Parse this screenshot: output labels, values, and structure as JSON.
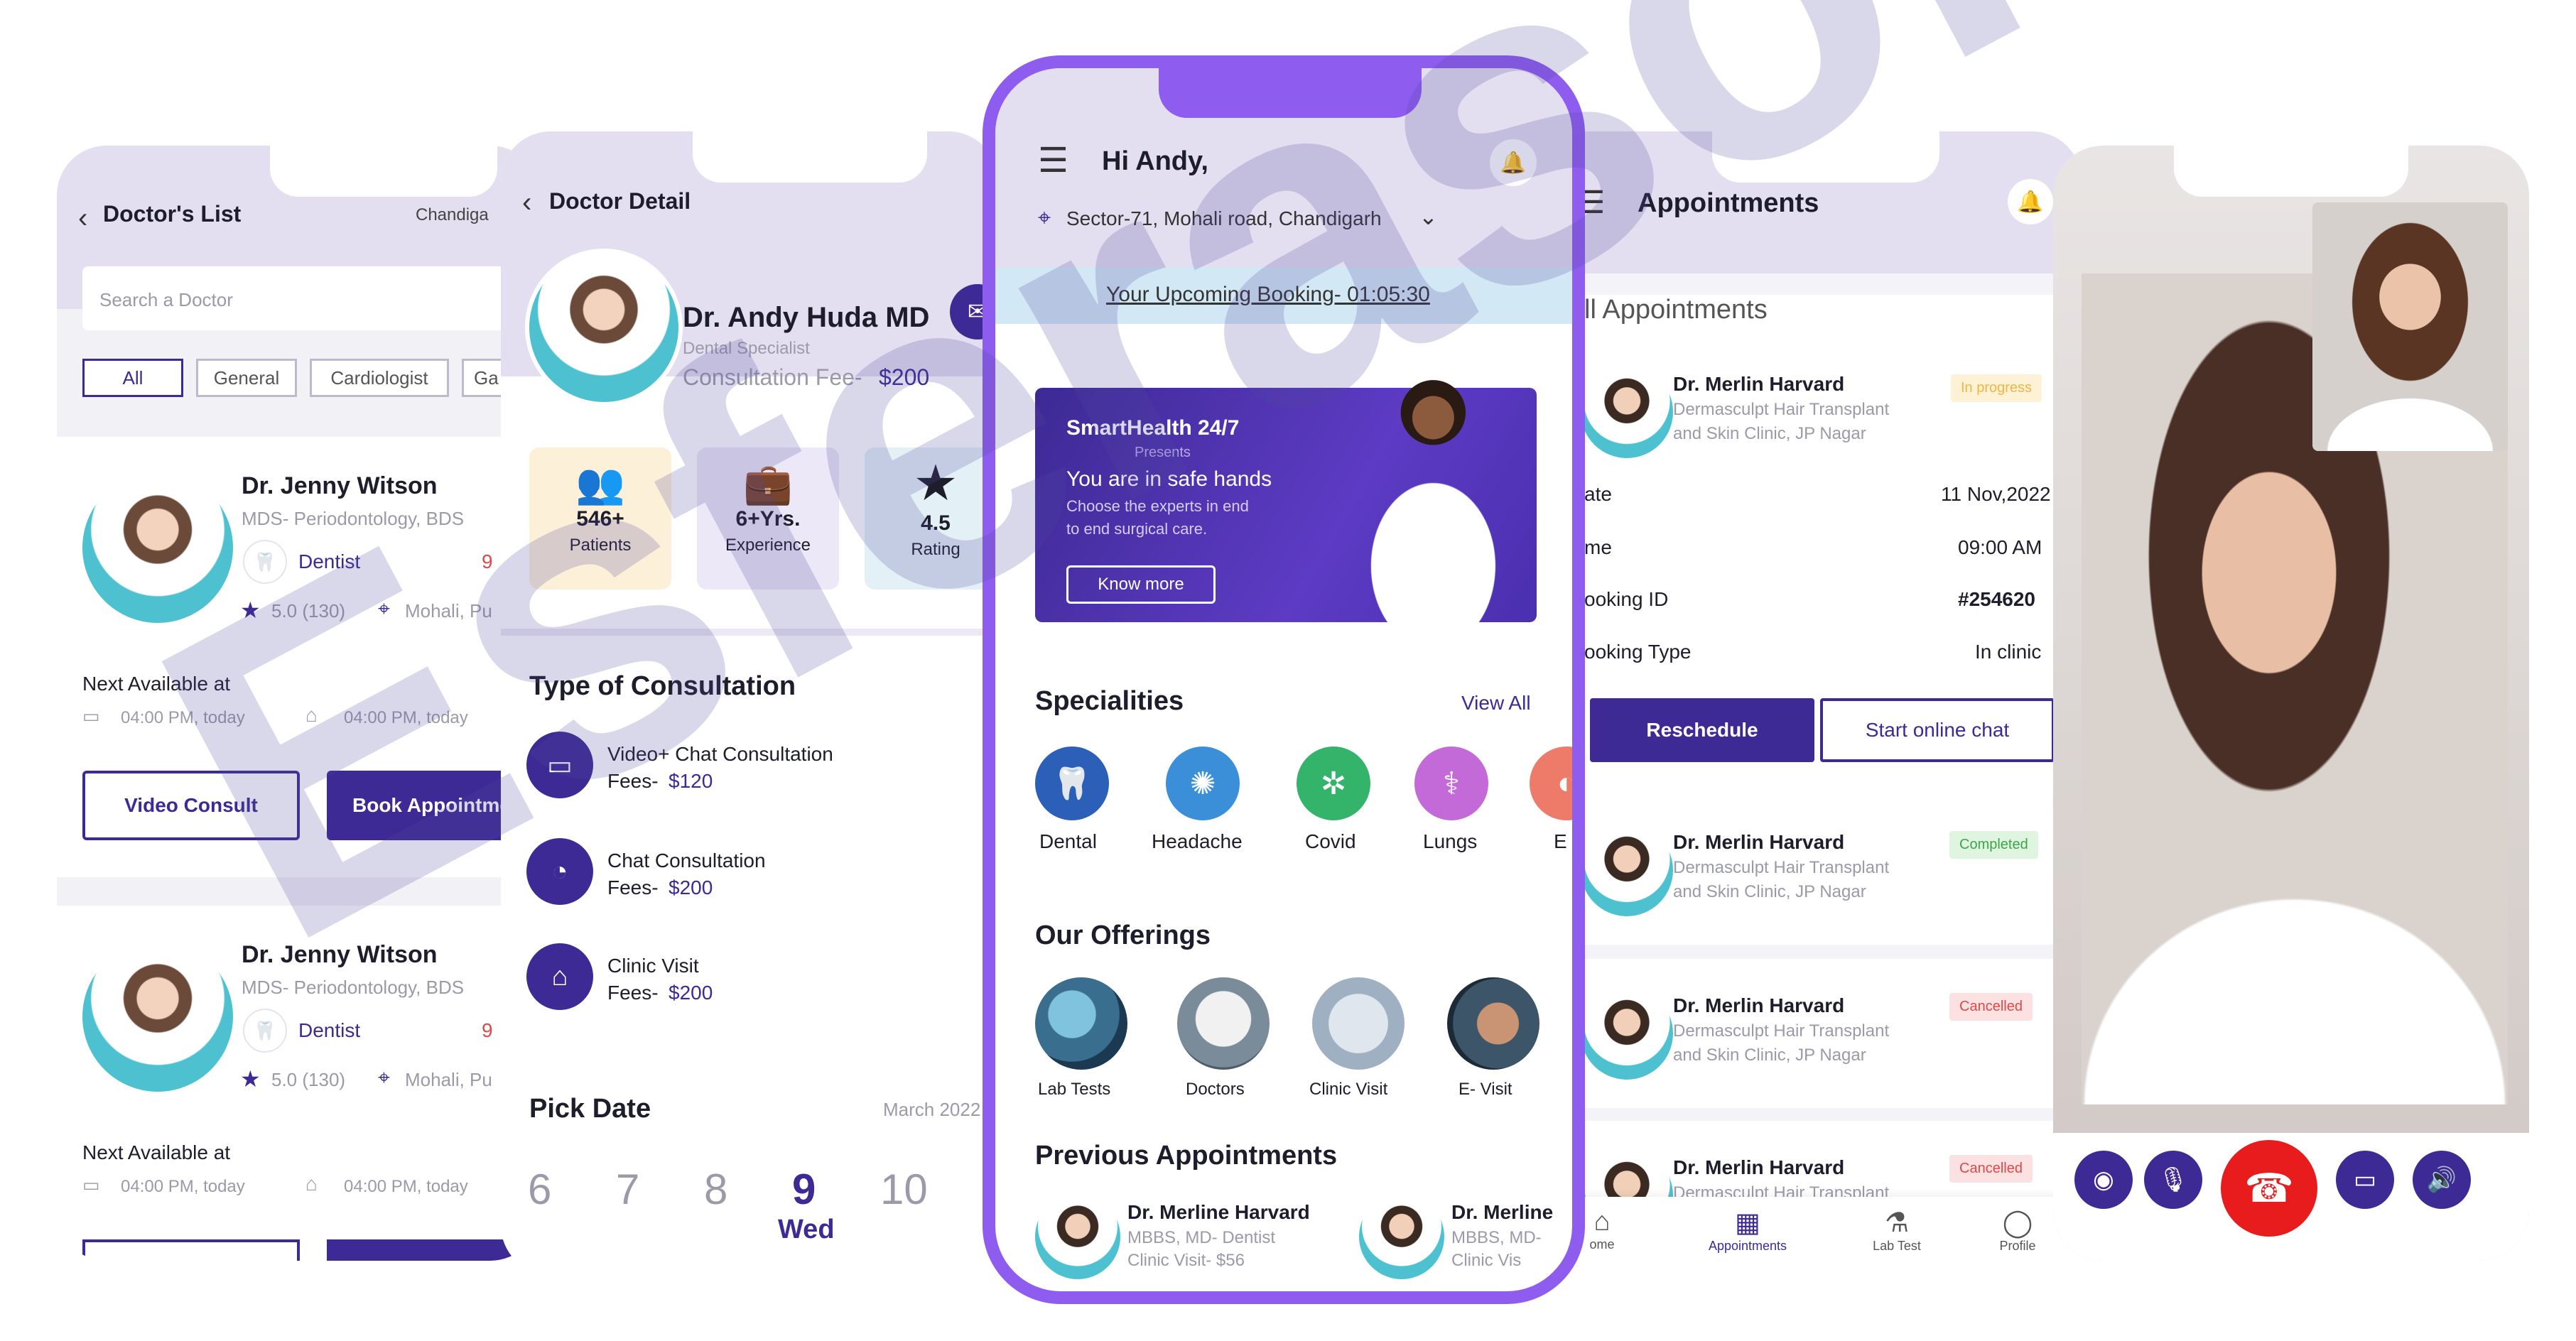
{
  "doctor_list": {
    "title": "Doctor's List",
    "location": "Chandiga",
    "search_placeholder": "Search a Doctor",
    "filters": [
      "All",
      "General",
      "Cardiologist",
      "Ga"
    ],
    "cards": [
      {
        "name": "Dr. Jenny Witson",
        "degree": "MDS- Periodontology, BDS",
        "specialty": "Dentist",
        "fee": "9",
        "rating": "5.0 (130)",
        "location": "Mohali, Pu",
        "next_label": "Next Available at",
        "slot_video": "04:00 PM, today",
        "slot_clinic": "04:00 PM, today",
        "video_btn": "Video Consult",
        "book_btn": "Book Appointme"
      },
      {
        "name": "Dr. Jenny Witson",
        "degree": "MDS- Periodontology, BDS",
        "specialty": "Dentist",
        "fee": "9",
        "rating": "5.0 (130)",
        "location": "Mohali, Pu",
        "next_label": "Next Available at",
        "slot_video": "04:00 PM, today",
        "slot_clinic": "04:00 PM, today"
      }
    ]
  },
  "doctor_detail": {
    "title": "Doctor Detail",
    "name": "Dr. Andy Huda MD",
    "specialist": "Dental Specialist",
    "fee_label": "Consultation Fee-",
    "fee": "$200",
    "stats": [
      {
        "value": "546+",
        "label": "Patients",
        "color": "#fdf0d9"
      },
      {
        "value": "6+Yrs.",
        "label": "Experience",
        "color": "#ece8f7"
      },
      {
        "value": "4.5",
        "label": "Rating",
        "color": "#e3f1f6"
      }
    ],
    "consult_heading": "Type of Consultation",
    "consultations": [
      {
        "title": "Video+ Chat Consultation",
        "fee_label": "Fees-",
        "fee": "$120"
      },
      {
        "title": "Chat Consultation",
        "fee_label": "Fees-",
        "fee": "$200"
      },
      {
        "title": "Clinic Visit",
        "fee_label": "Fees-",
        "fee": "$200"
      }
    ],
    "pick_date": "Pick Date",
    "month": "March 2022",
    "dates": [
      "6",
      "7",
      "8",
      "9",
      "10"
    ],
    "selected_day": "Wed"
  },
  "home": {
    "greeting": "Hi Andy,",
    "location": "Sector-71, Mohali road, Chandigarh",
    "upcoming": "Your Upcoming Booking- 01:05:30",
    "banner": {
      "brand": "SmartHealth 24/7",
      "presents": "Presents",
      "headline": "You are in safe hands",
      "sub1": "Choose the experts in end",
      "sub2": "to end surgical care.",
      "cta": "Know more"
    },
    "specialities_title": "Specialities",
    "view_all": "View All",
    "specialities": [
      {
        "label": "Dental",
        "color": "#2c5fb8"
      },
      {
        "label": "Headache",
        "color": "#3a8fd8"
      },
      {
        "label": "Covid",
        "color": "#34b36a"
      },
      {
        "label": "Lungs",
        "color": "#c46ad8"
      },
      {
        "label": "E",
        "color": "#ee7a6a"
      }
    ],
    "offerings_title": "Our Offerings",
    "offerings": [
      "Lab Tests",
      "Doctors",
      "Clinic Visit",
      "E- Visit"
    ],
    "previous_title": "Previous Appointments",
    "previous": [
      {
        "name": "Dr. Merline Harvard",
        "degree": "MBBS, MD- Dentist",
        "visit": "Clinic Visit- $56"
      },
      {
        "name": "Dr. Merline",
        "degree": "MBBS, MD-",
        "visit": "Clinic Vis"
      }
    ]
  },
  "appointments": {
    "title": "Appointments",
    "section": "ll Appointments",
    "first": {
      "name": "Dr. Merlin Harvard",
      "clinic1": "Dermasculpt Hair Transplant",
      "clinic2": "and Skin Clinic, JP Nagar",
      "status": "In progress",
      "rows": [
        [
          "ate",
          "11 Nov,2022"
        ],
        [
          "me",
          "09:00 AM"
        ],
        [
          "ooking ID",
          "#254620"
        ],
        [
          "ooking Type",
          "In clinic"
        ]
      ],
      "reschedule": "Reschedule",
      "chat": "Start online chat"
    },
    "others": [
      {
        "name": "Dr. Merlin Harvard",
        "clinic1": "Dermasculpt Hair Transplant",
        "clinic2": "and Skin Clinic, JP Nagar",
        "status": "Completed",
        "status_bg": "#dff5df",
        "status_fg": "#3aa84a"
      },
      {
        "name": "Dr. Merlin Harvard",
        "clinic1": "Dermasculpt Hair Transplant",
        "clinic2": "and Skin Clinic, JP Nagar",
        "status": "Cancelled",
        "status_bg": "#fbe1e1",
        "status_fg": "#e04848"
      },
      {
        "name": "Dr. Merlin Harvard",
        "clinic1": "Dermasculpt Hair Transplant",
        "clinic2": "",
        "status": "Cancelled",
        "status_bg": "#fbe1e1",
        "status_fg": "#e04848"
      }
    ],
    "tabs": [
      "ome",
      "Appointments",
      "Lab Test",
      "Profile"
    ]
  },
  "watermark": "Esferasoft"
}
